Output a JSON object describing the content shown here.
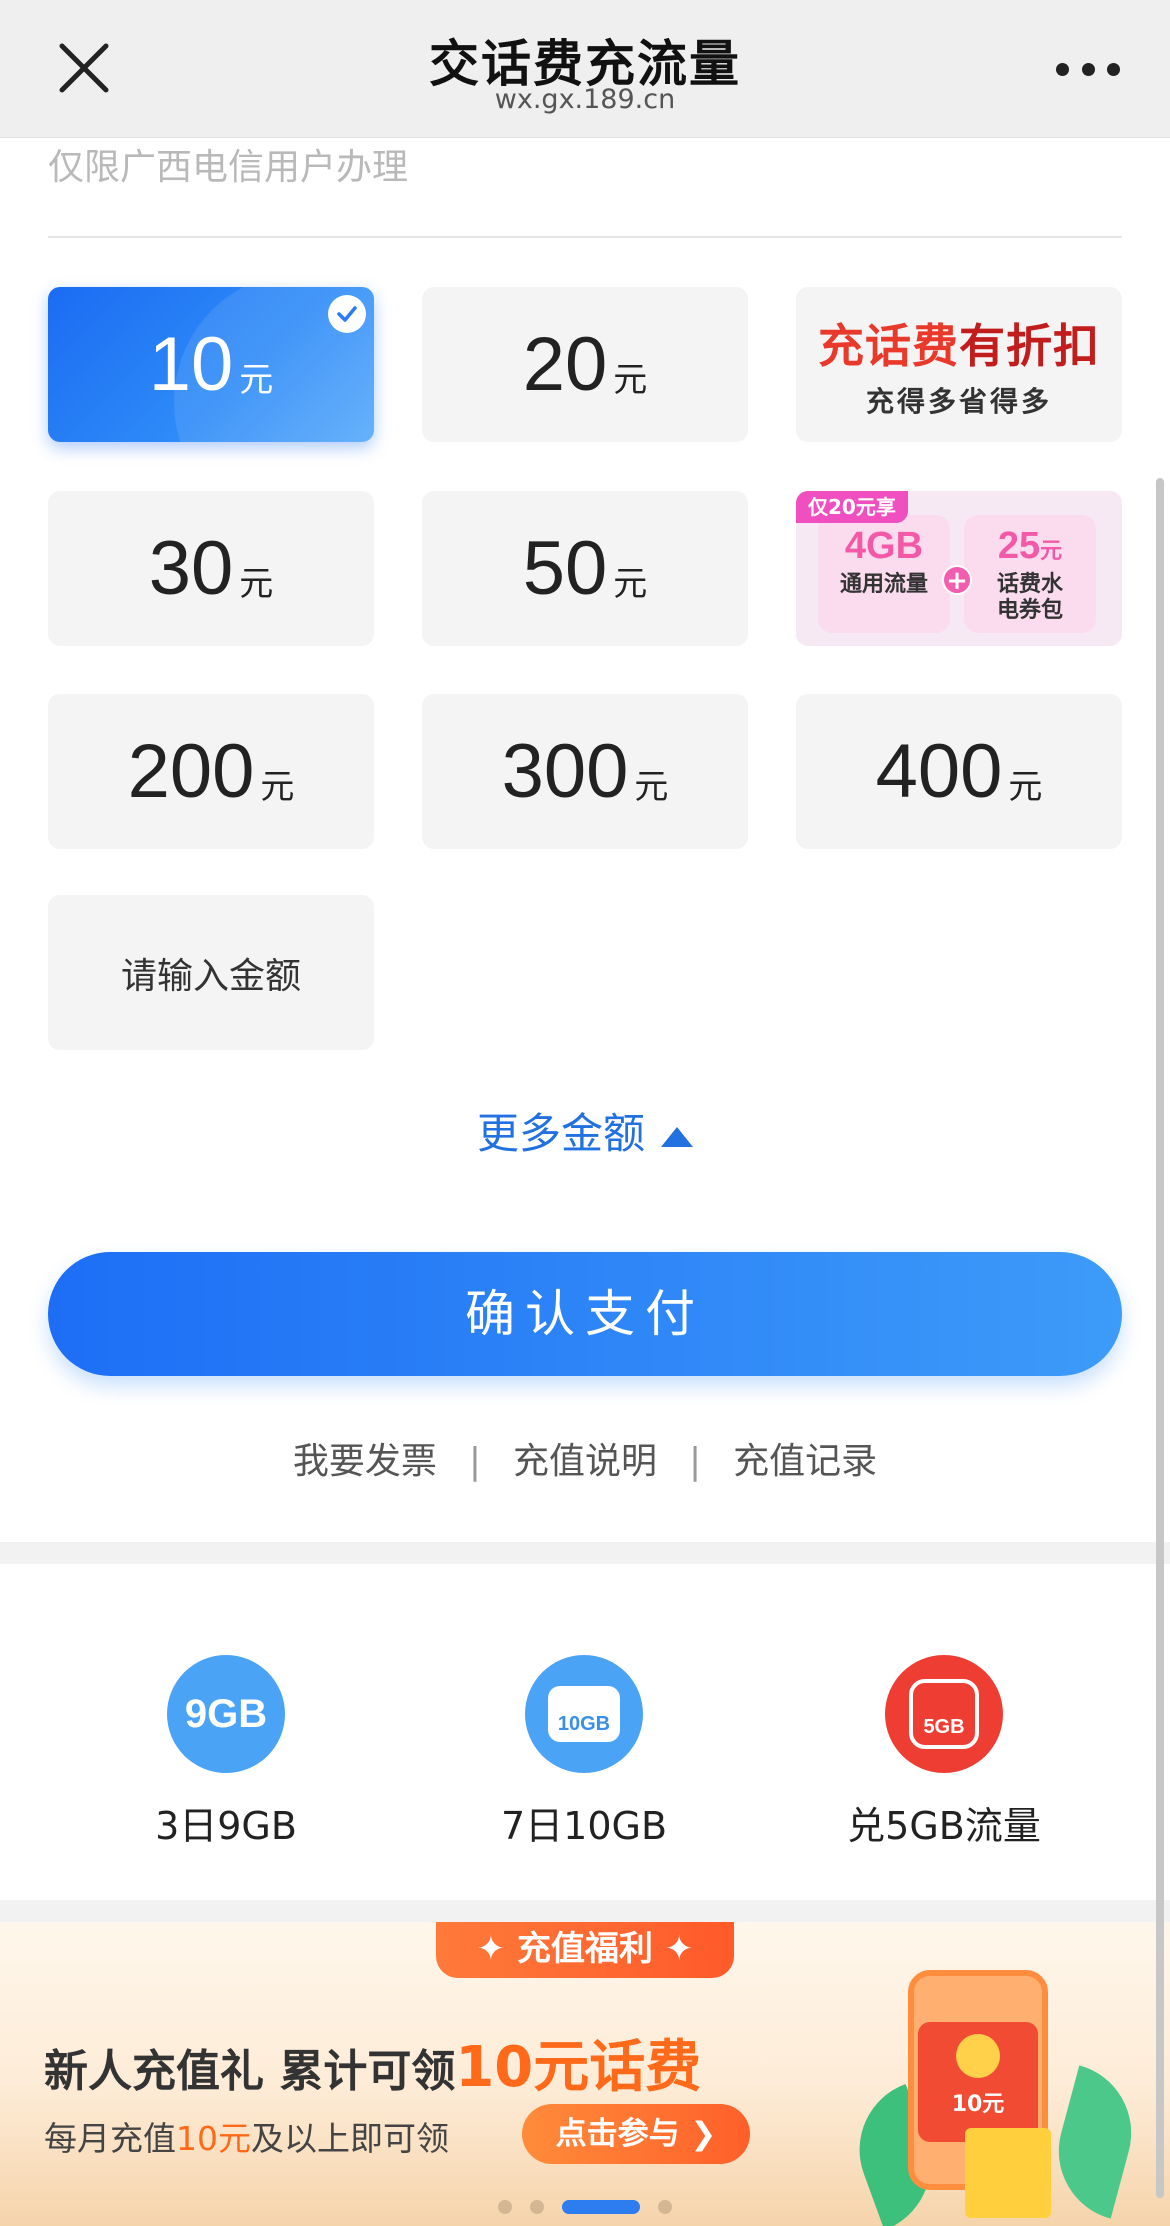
{
  "header": {
    "title": "交话费充流量",
    "domain": "wx.gx.189.cn"
  },
  "hint": "仅限广西电信用户办理",
  "amounts": {
    "unit": "元",
    "items": [
      {
        "value": "10",
        "selected": true
      },
      {
        "value": "20"
      },
      {
        "value": "30"
      },
      {
        "value": "50"
      },
      {
        "value": "200"
      },
      {
        "value": "300"
      },
      {
        "value": "400"
      }
    ],
    "custom_placeholder": "请输入金额"
  },
  "promo_discount": {
    "title_a": "充话费",
    "title_b": "有折扣",
    "subtitle": "充得多省得多"
  },
  "promo_bundle": {
    "tag": "仅20元享",
    "data_amount": "4GB",
    "data_desc": "通用流量",
    "plus": "+",
    "coupon_amount": "25",
    "coupon_unit": "元",
    "coupon_desc_1": "话费水",
    "coupon_desc_2": "电券包"
  },
  "more_amounts_label": "更多金额",
  "confirm_label": "确认支付",
  "links": {
    "invoice": "我要发票",
    "instructions": "充值说明",
    "records": "充值记录",
    "separator": "|"
  },
  "shortcuts": [
    {
      "icon_text": "9GB",
      "label": "3日9GB",
      "color": "#4aa3f5",
      "icon": "data-9gb-icon"
    },
    {
      "icon_text": "10GB",
      "label": "7日10GB",
      "color": "#4aa3f5",
      "icon": "sim-card-icon"
    },
    {
      "icon_text": "5GB",
      "label": "兑5GB流量",
      "color": "#ee3d33",
      "icon": "exchange-icon"
    }
  ],
  "banner": {
    "badge": "✦ 充值福利 ✦",
    "title": "新人充值礼 累计可领",
    "title_highlight": "10元话费",
    "sub_prefix": "每月充值",
    "sub_highlight": "10元",
    "sub_suffix": "及以上即可领",
    "cta": "点击参与 ❯",
    "envelope_text": "10元"
  },
  "colors": {
    "accent": "#1d6ef5",
    "link": "#2271e0",
    "highlight": "#ff6a1a"
  }
}
